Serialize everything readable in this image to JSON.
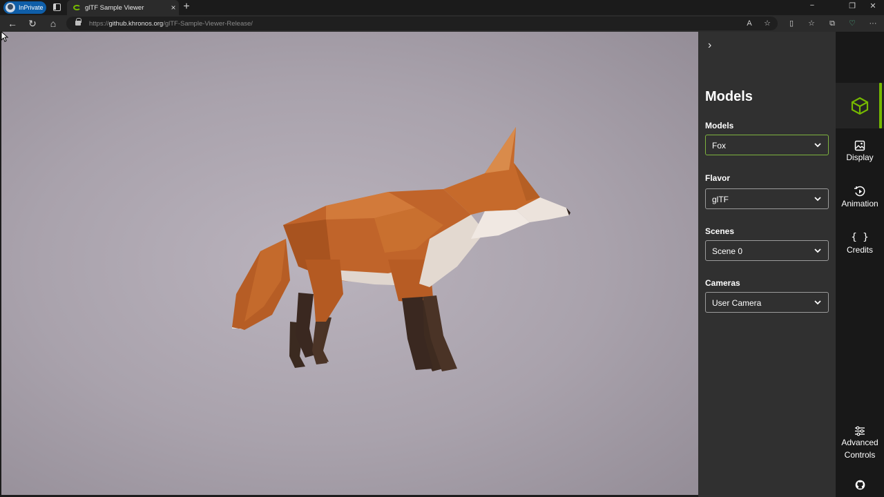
{
  "browser": {
    "inprivate_label": "InPrivate",
    "tab_title": "glTF Sample Viewer",
    "url_domain": "github.khronos.org",
    "url_path": "/glTF-Sample-Viewer-Release/"
  },
  "panel": {
    "heading": "Models",
    "fields": [
      {
        "label": "Models",
        "value": "Fox"
      },
      {
        "label": "Flavor",
        "value": "glTF"
      },
      {
        "label": "Scenes",
        "value": "Scene 0"
      },
      {
        "label": "Cameras",
        "value": "User Camera"
      }
    ]
  },
  "sidebar": {
    "display": "Display",
    "animation": "Animation",
    "credits": "Credits",
    "advanced_line1": "Advanced",
    "advanced_line2": "Controls"
  },
  "colors": {
    "accent": "#76b900",
    "panel_bg": "#303030",
    "sidebar_bg": "#181818"
  }
}
